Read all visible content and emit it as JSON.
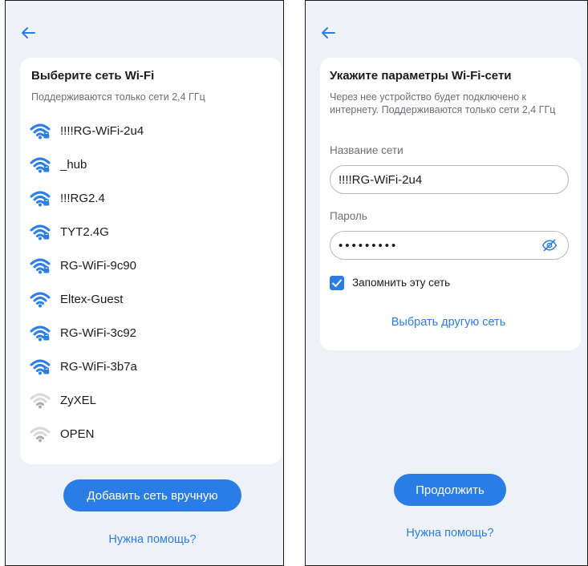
{
  "left_screen": {
    "title": "Выберите сеть Wi-Fi",
    "subtitle": "Поддерживаются только сети 2,4 ГГц",
    "networks": [
      {
        "name": "!!!!RG-WiFi-2u4",
        "icon": "wifi-lock-icon",
        "color": "#2b7de6"
      },
      {
        "name": "_hub",
        "icon": "wifi-lock-icon",
        "color": "#2b7de6"
      },
      {
        "name": "!!!RG2.4",
        "icon": "wifi-lock-icon",
        "color": "#2b7de6"
      },
      {
        "name": "TYT2.4G",
        "icon": "wifi-lock-icon",
        "color": "#2b7de6"
      },
      {
        "name": "RG-WiFi-9c90",
        "icon": "wifi-lock-icon",
        "color": "#2b7de6"
      },
      {
        "name": "Eltex-Guest",
        "icon": "wifi-icon",
        "color": "#2b7de6"
      },
      {
        "name": "RG-WiFi-3c92",
        "icon": "wifi-lock-icon",
        "color": "#2b7de6"
      },
      {
        "name": "RG-WiFi-3b7a",
        "icon": "wifi-lock-icon",
        "color": "#2b7de6"
      },
      {
        "name": "ZyXEL",
        "icon": "wifi-weak-icon",
        "color": "#a9acb3"
      },
      {
        "name": "OPEN",
        "icon": "wifi-weak-icon",
        "color": "#a9acb3"
      }
    ],
    "add_button": "Добавить сеть вручную",
    "help_link": "Нужна помощь?"
  },
  "right_screen": {
    "title": "Укажите параметры Wi-Fi-сети",
    "subtitle": "Через нее устройство будет подключено к интернету. Поддерживаются только сети 2,4 ГГц",
    "network_label": "Название сети",
    "network_value": "!!!!RG-WiFi-2u4",
    "password_label": "Пароль",
    "password_value": "•••••••••",
    "remember_label": "Запомнить эту сеть",
    "remember_checked": true,
    "other_network_link": "Выбрать другую сеть",
    "continue_button": "Продолжить",
    "help_link": "Нужна помощь?"
  },
  "colors": {
    "accent": "#2b7de6",
    "background": "#eef2f8",
    "card": "#ffffff"
  }
}
